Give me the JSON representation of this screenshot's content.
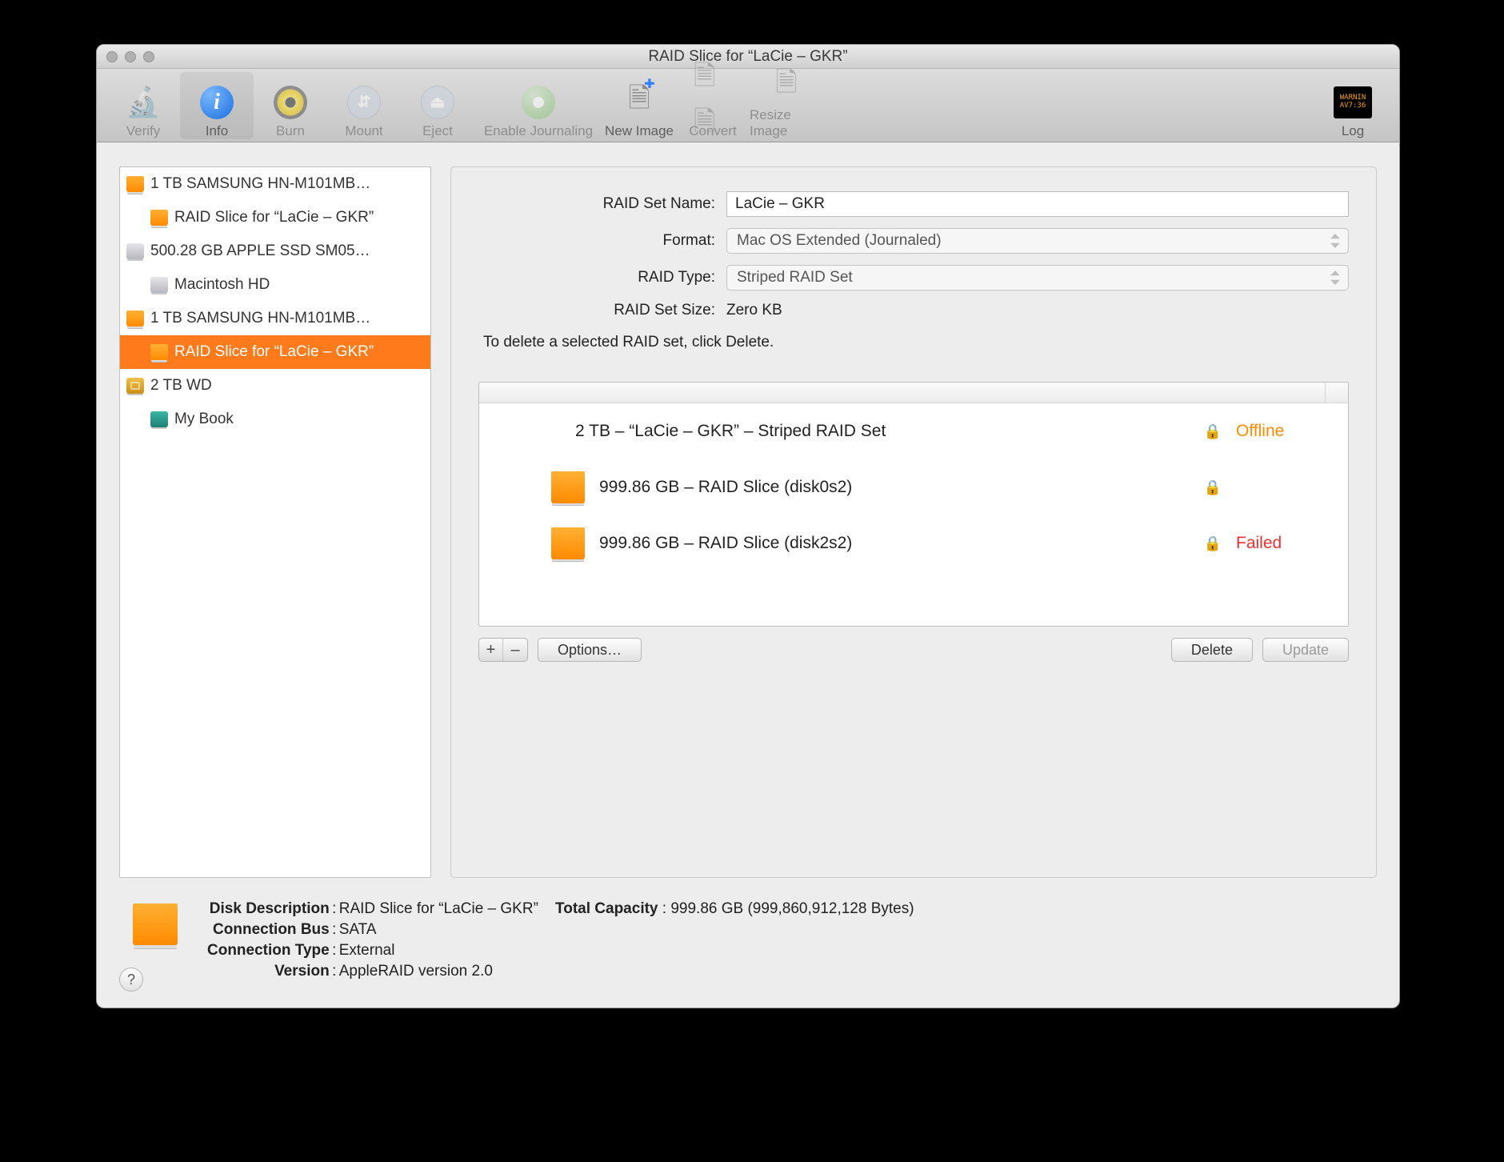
{
  "window": {
    "title": "RAID Slice for “LaCie – GKR”"
  },
  "toolbar": {
    "items": [
      {
        "label": "Verify",
        "name": "verify-button",
        "dim": true
      },
      {
        "label": "Info",
        "name": "info-button",
        "selected": true
      },
      {
        "label": "Burn",
        "name": "burn-button",
        "dim": true
      },
      {
        "label": "Mount",
        "name": "mount-button",
        "dim": true
      },
      {
        "label": "Eject",
        "name": "eject-button",
        "dim": true
      },
      {
        "label": "Enable Journaling",
        "name": "enable-journaling-button",
        "dim": true,
        "wide": true
      },
      {
        "label": "New Image",
        "name": "new-image-button"
      },
      {
        "label": "Convert",
        "name": "convert-button",
        "dim": true
      },
      {
        "label": "Resize Image",
        "name": "resize-image-button",
        "dim": true
      }
    ],
    "log_label": "Log",
    "log_badge": "WARNIN\\nAV7:36"
  },
  "sidebar": {
    "items": [
      {
        "label": "1 TB SAMSUNG HN-M101MB…",
        "icon": "orange",
        "indent": 0
      },
      {
        "label": "RAID Slice for “LaCie – GKR”",
        "icon": "orange",
        "indent": 1
      },
      {
        "label": "500.28 GB APPLE SSD SM05…",
        "icon": "silver",
        "indent": 0
      },
      {
        "label": "Macintosh HD",
        "icon": "silver",
        "indent": 1
      },
      {
        "label": "1 TB SAMSUNG HN-M101MB…",
        "icon": "orange",
        "indent": 0
      },
      {
        "label": "RAID Slice for “LaCie – GKR”",
        "icon": "orange",
        "indent": 1,
        "selected": true
      },
      {
        "label": "2 TB WD",
        "icon": "gold",
        "indent": 0
      },
      {
        "label": "My Book",
        "icon": "teal",
        "indent": 1
      }
    ]
  },
  "form": {
    "name_label": "RAID Set Name:",
    "name_value": "LaCie – GKR",
    "format_label": "Format:",
    "format_value": "Mac OS Extended (Journaled)",
    "type_label": "RAID Type:",
    "type_value": "Striped RAID Set",
    "size_label": "RAID Set Size:",
    "size_value": "Zero KB",
    "hint": "To delete a selected RAID set, click Delete."
  },
  "members": [
    {
      "text": "2 TB – “LaCie – GKR” – Striped RAID Set",
      "indent": 0,
      "icon": "none",
      "lock": true,
      "status": "Offline",
      "status_class": "orange-text"
    },
    {
      "text": "999.86 GB – RAID Slice (disk0s2)",
      "indent": 1,
      "icon": "orange",
      "lock": true,
      "status": "",
      "status_class": ""
    },
    {
      "text": "999.86 GB – RAID Slice (disk2s2)",
      "indent": 1,
      "icon": "orange",
      "lock": true,
      "status": "Failed",
      "status_class": "red-text"
    }
  ],
  "members_buttons": {
    "add": "+",
    "remove": "–",
    "options": "Options…",
    "delete": "Delete",
    "update": "Update"
  },
  "footer": {
    "disk_description_k": "Disk Description",
    "disk_description_v": "RAID Slice for “LaCie – GKR”",
    "total_capacity_k": "Total Capacity",
    "total_capacity_v": "999.86 GB (999,860,912,128 Bytes)",
    "connection_bus_k": "Connection Bus",
    "connection_bus_v": "SATA",
    "connection_type_k": "Connection Type",
    "connection_type_v": "External",
    "version_k": "Version",
    "version_v": "AppleRAID version 2.0"
  }
}
